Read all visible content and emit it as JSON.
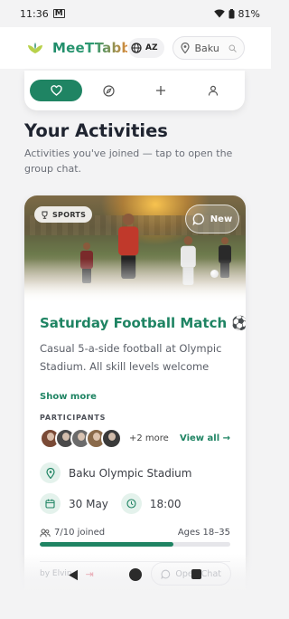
{
  "status_bar": {
    "time": "11:36",
    "battery": "81%"
  },
  "header": {
    "brand": "MeeTTabb",
    "language": "AZ",
    "location": "Baku"
  },
  "tabs": [
    {
      "icon": "heart-icon",
      "active": true
    },
    {
      "icon": "compass-icon",
      "active": false
    },
    {
      "icon": "plus-icon",
      "active": false
    },
    {
      "icon": "user-icon",
      "active": false
    }
  ],
  "page": {
    "title": "Your Activities",
    "subtitle": "Activities you've joined — tap to open the group chat."
  },
  "activity": {
    "category": "SPORTS",
    "new_label": "New",
    "title": "Saturday Football Match ⚽",
    "description": "Casual 5-a-side football at Olympic Stadium. All skill levels welcome —...",
    "show_more": "Show more",
    "participants_label": "PARTICIPANTS",
    "more_participants": "+2 more",
    "view_all": "View all →",
    "location": "Baku Olympic Stadium",
    "date": "30 May",
    "time": "18:00",
    "joined": "7/10 joined",
    "joined_fraction": 0.7,
    "ages": "Ages 18–35",
    "organizer": "by Elvin",
    "open_chat": "Open Chat",
    "avatar_colors": [
      "#7a4a36",
      "#4a4a4a",
      "#6b6b6b",
      "#8a6a4a",
      "#3a3a3a"
    ]
  },
  "colors": {
    "accent": "#1f8463",
    "accent_light": "#e4f2ec"
  }
}
